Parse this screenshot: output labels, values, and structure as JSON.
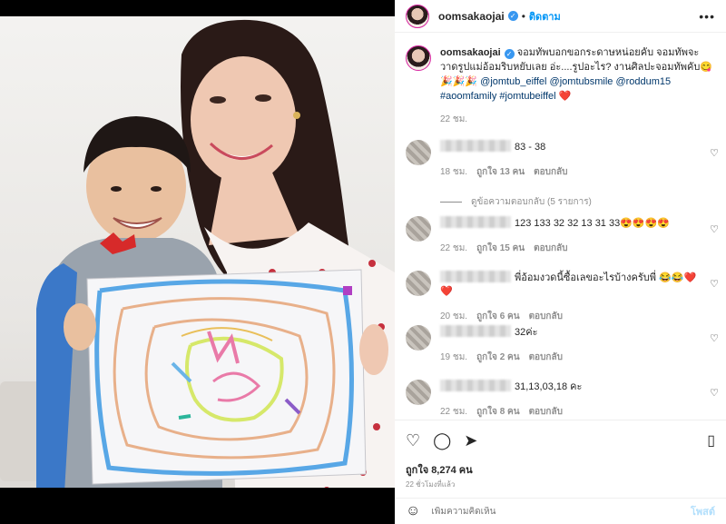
{
  "post": {
    "username": "oomsakaojai",
    "follow_label": "ติดตาม",
    "more_icon": "more-horizontal-icon"
  },
  "caption": {
    "username": "oomsakaojai",
    "text": "จอมทัพบอกขอกระดาษหน่อยคับ จอมทัพจะวาดรูปแม่อ้อมริบหยับเลย อ่ะ....รูปอะไร? งานศิลปะจอมทัพคับ😋🎉🎉🎉",
    "tags": "@jomtub_eiffel @jomtubsmile @roddum15 #aoomfamily #jomtubeiffel",
    "heart": "❤️",
    "time": "22 ชม."
  },
  "comments": [
    {
      "text": "83 - 38",
      "time": "18 ชม.",
      "likes": "ถูกใจ 13 คน",
      "reply": "ตอบกลับ"
    },
    {
      "text": "123 133 32 32 13 31 33😍😍😍😍",
      "time": "22 ชม.",
      "likes": "ถูกใจ 15 คน",
      "reply": "ตอบกลับ"
    },
    {
      "text": "พี่อ้อมงวดนี้ซื้อเลขอะไรบ้างครับพี่ 😂😂❤️❤️",
      "time": "20 ชม.",
      "likes": "ถูกใจ 6 คน",
      "reply": "ตอบกลับ"
    },
    {
      "text": "32ค่ะ",
      "time": "19 ชม.",
      "likes": "ถูกใจ 2 คน",
      "reply": "ตอบกลับ"
    },
    {
      "text": "31,13,03,18 คะ",
      "time": "22 ชม.",
      "likes": "ถูกใจ 8 คน",
      "reply": "ตอบกลับ"
    }
  ],
  "replies_label": "ดูข้อความตอบกลับ (5 รายการ)",
  "actions": {
    "like_icon": "heart-icon",
    "comment_icon": "comment-icon",
    "share_icon": "share-icon",
    "save_icon": "bookmark-icon",
    "likes": "ถูกใจ 8,274 คน",
    "ago": "22 ชั่วโมงที่แล้ว"
  },
  "add_comment": {
    "placeholder": "เพิ่มความคิดเห็น",
    "post_label": "โพสต์",
    "emoji_icon": "smiley-icon"
  }
}
